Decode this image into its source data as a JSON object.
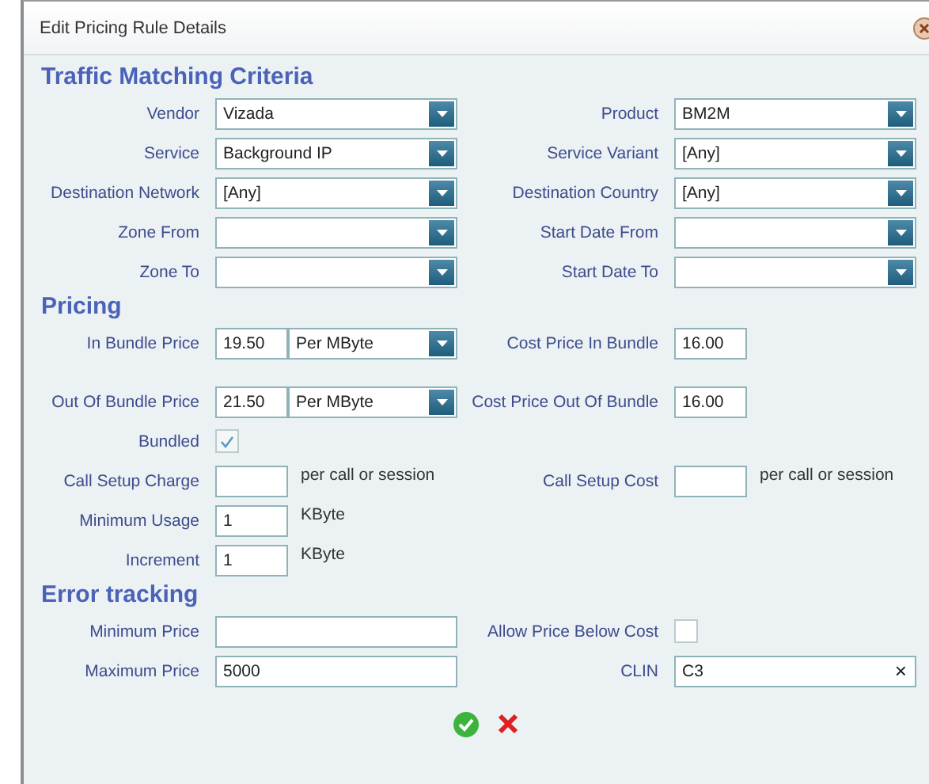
{
  "window": {
    "title": "Edit Pricing Rule Details"
  },
  "sections": [
    {
      "title": "Traffic Matching Criteria",
      "rows": [
        {
          "left": {
            "kind": "select",
            "label": "Vendor",
            "value": "Vizada"
          },
          "right": {
            "kind": "select",
            "label": "Product",
            "value": "BM2M"
          }
        },
        {
          "left": {
            "kind": "select",
            "label": "Service",
            "value": "Background IP"
          },
          "right": {
            "kind": "select",
            "label": "Service Variant",
            "value": "[Any]"
          }
        },
        {
          "left": {
            "kind": "select",
            "label": "Destination Network",
            "value": "[Any]"
          },
          "right": {
            "kind": "select",
            "label": "Destination Country",
            "value": "[Any]"
          }
        },
        {
          "left": {
            "kind": "select",
            "label": "Zone From"
          },
          "right": {
            "kind": "select",
            "label": "Start Date From"
          }
        },
        {
          "left": {
            "kind": "select",
            "label": "Zone To"
          },
          "right": {
            "kind": "select",
            "label": "Start Date To"
          }
        }
      ]
    },
    {
      "title": "Pricing",
      "rows": [
        {
          "left": {
            "kind": "price",
            "label": "In Bundle Price",
            "value": "19.50",
            "unit": "Per MByte"
          },
          "right": {
            "kind": "short",
            "label": "Cost Price In Bundle",
            "value": "16.00"
          }
        },
        {
          "left": {
            "kind": "price",
            "label": "Out Of Bundle Price",
            "value": "21.50",
            "unit": "Per MByte"
          },
          "right": {
            "kind": "short",
            "label": "Cost Price Out Of Bundle",
            "value": "16.00"
          }
        },
        {
          "left": {
            "kind": "checkbox",
            "label": "Bundled",
            "checked": true
          }
        },
        {
          "left": {
            "kind": "short",
            "label": "Call Setup Charge",
            "suffix": "per call or session"
          },
          "right": {
            "kind": "short",
            "label": "Call Setup Cost",
            "suffix": "per call or session"
          }
        },
        {
          "left": {
            "kind": "short",
            "label": "Minimum Usage",
            "value": "1",
            "suffix": "KByte"
          }
        },
        {
          "left": {
            "kind": "short",
            "label": "Increment",
            "value": "1",
            "suffix": "KByte"
          }
        }
      ]
    },
    {
      "title": "Error tracking",
      "rows": [
        {
          "left": {
            "kind": "text",
            "label": "Minimum Price"
          },
          "right": {
            "kind": "checkbox",
            "label": "Allow Price Below Cost",
            "checked": false
          }
        },
        {
          "left": {
            "kind": "text",
            "label": "Maximum Price",
            "value": "5000"
          },
          "right": {
            "kind": "clearable",
            "label": "CLIN",
            "value": "C3",
            "clear": "×"
          }
        }
      ]
    }
  ]
}
